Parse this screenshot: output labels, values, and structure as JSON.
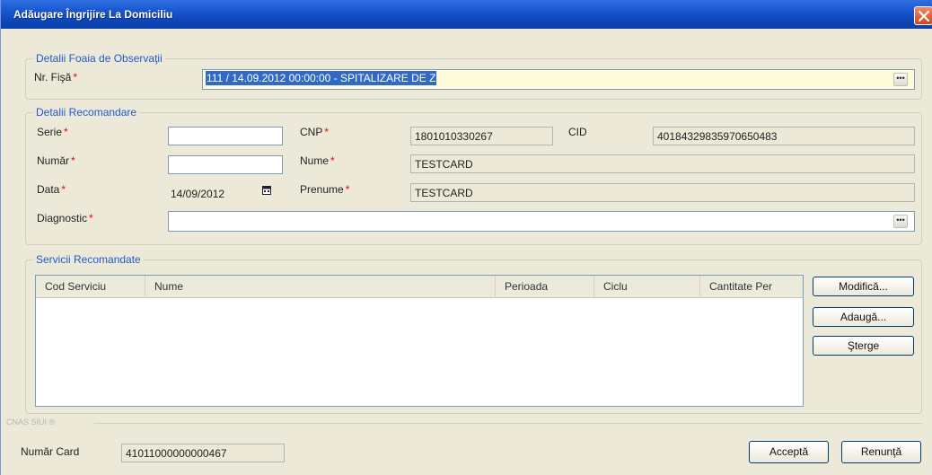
{
  "window": {
    "title": "Adăugare Îngrijire La Domiciliu",
    "title_bar_color": "#0f47b8",
    "close_icon": "close-icon"
  },
  "foaia": {
    "legend": "Detalii Foaia de Observaţii",
    "nr_fisa_label": "Nr. Fişă",
    "nr_fisa_value": "111 / 14.09.2012 00:00:00 - SPITALIZARE DE Z"
  },
  "recomandare": {
    "legend": "Detalii Recomandare",
    "serie_label": "Serie",
    "serie_value": "",
    "numar_label": "Număr",
    "numar_value": "",
    "data_label": "Data",
    "data_value": "14/09/2012",
    "diagnostic_label": "Diagnostic",
    "diagnostic_value": "",
    "cnp_label": "CNP",
    "cnp_value": "1801010330267",
    "cid_label": "CID",
    "cid_value": "40184329835970650483",
    "nume_label": "Nume",
    "nume_value": "TESTCARD",
    "prenume_label": "Prenume",
    "prenume_value": "TESTCARD"
  },
  "servicii": {
    "legend": "Servicii Recomandate",
    "columns": [
      "Cod Serviciu",
      "Nume",
      "Perioada",
      "Ciclu",
      "Cantitate Per"
    ],
    "rows": [],
    "modifica_label": "Modifică...",
    "adauga_label": "Adaugă...",
    "sterge_label": "Şterge"
  },
  "footer": {
    "cnas_label": "CNAS SIUI ®",
    "numar_card_label": "Număr Card",
    "numar_card_value": "41011000000000467",
    "accepta_label": "Acceptă",
    "renunta_label": "Renunţă"
  },
  "required_marker": "*",
  "required_color": "#e00000",
  "accent_color": "#1f5bcf"
}
